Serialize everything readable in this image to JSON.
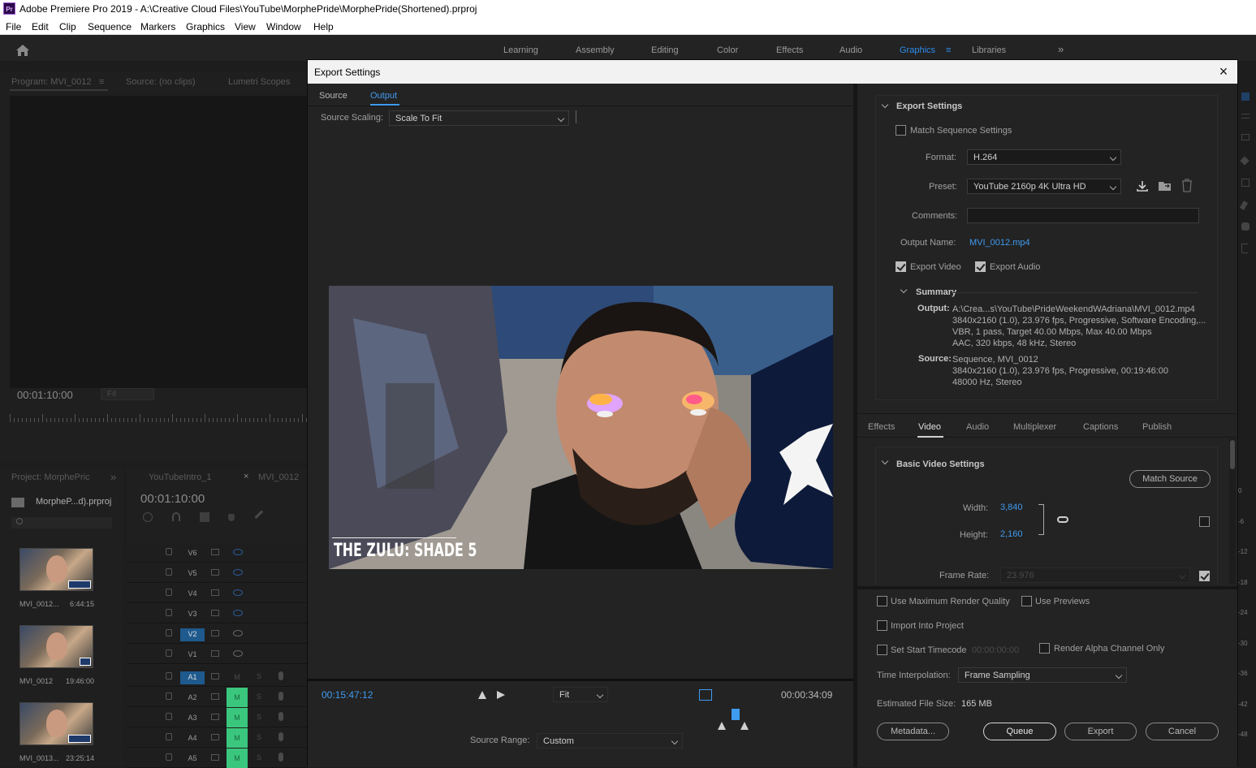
{
  "app": {
    "title": "Adobe Premiere Pro 2019 - A:\\Creative Cloud Files\\YouTube\\MorphePride\\MorphePride(Shortened).prproj",
    "logo": "Pr",
    "menu": [
      "File",
      "Edit",
      "Clip",
      "Sequence",
      "Markers",
      "Graphics",
      "View",
      "Window",
      "Help"
    ]
  },
  "workspaces": {
    "items": [
      "Learning",
      "Assembly",
      "Editing",
      "Color",
      "Effects",
      "Audio",
      "Graphics",
      "Libraries"
    ],
    "active": "Graphics",
    "more": "»",
    "menu_icon": "≡"
  },
  "monitor": {
    "tabs": [
      "Program: MVI_0012",
      "≡",
      "Source: (no clips)",
      "Lumetri Scopes"
    ],
    "timecode": "00:01:10:00",
    "fit": "Fit"
  },
  "project": {
    "tab": "Project: MorphePric",
    "more": "»",
    "file": "MorpheP...d).prproj",
    "clips": [
      {
        "name": "MVI_0012...",
        "duration": "6:44:15"
      },
      {
        "name": "MVI_0012",
        "duration": "19:46:00"
      },
      {
        "name": "MVI_0013...",
        "duration": "23:25:14"
      }
    ]
  },
  "timeline": {
    "tabs": [
      "YouTubeIntro_1",
      "×",
      "MVI_0012"
    ],
    "timecode": "00:01:10:00",
    "tracks": [
      {
        "name": "V6",
        "type": "video"
      },
      {
        "name": "V5",
        "type": "video"
      },
      {
        "name": "V4",
        "type": "video"
      },
      {
        "name": "V3",
        "type": "video"
      },
      {
        "name": "V2",
        "type": "video",
        "selected": true
      },
      {
        "name": "V1",
        "type": "video"
      },
      {
        "name": "A1",
        "type": "audio",
        "selected": true
      },
      {
        "name": "A2",
        "type": "audio"
      },
      {
        "name": "A3",
        "type": "audio"
      },
      {
        "name": "A4",
        "type": "audio"
      },
      {
        "name": "A5",
        "type": "audio"
      }
    ],
    "m_label": "M",
    "s_label": "S"
  },
  "meter_labels": [
    "0",
    "-6",
    "-12",
    "-18",
    "-24",
    "-30",
    "-36",
    "-42",
    "-48"
  ],
  "dialog": {
    "title": "Export Settings",
    "close": "×",
    "left_tabs": [
      "Source",
      "Output"
    ],
    "active_left_tab": "Output",
    "source_scaling_label": "Source Scaling:",
    "source_scaling_value": "Scale To Fit",
    "preview_caption": "THE ZULU: SHADE 5",
    "timecode_in": "00:15:47:12",
    "timecode_out": "00:00:34:09",
    "zoom_value": "Fit",
    "source_range_label": "Source Range:",
    "source_range_value": "Custom",
    "export_settings": {
      "header": "Export Settings",
      "match_sequence": "Match Sequence Settings",
      "format_label": "Format:",
      "format_value": "H.264",
      "preset_label": "Preset:",
      "preset_value": "YouTube 2160p 4K Ultra HD",
      "comments_label": "Comments:",
      "comments_value": "",
      "output_name_label": "Output Name:",
      "output_name_value": "MVI_0012.mp4",
      "export_video": "Export Video",
      "export_audio": "Export Audio"
    },
    "summary": {
      "header": "Summary",
      "output_label": "Output:",
      "output_lines": [
        "A:\\Crea...s\\YouTube\\PrideWeekendWAdriana\\MVI_0012.mp4",
        "3840x2160 (1.0), 23.976 fps, Progressive, Software Encoding,...",
        "VBR, 1 pass, Target 40.00 Mbps, Max 40.00 Mbps",
        "AAC, 320 kbps, 48 kHz, Stereo"
      ],
      "source_label": "Source:",
      "source_lines": [
        "Sequence, MVI_0012",
        "3840x2160 (1.0), 23.976 fps, Progressive, 00:19:46:00",
        "48000 Hz, Stereo"
      ]
    },
    "right_tabs": [
      "Effects",
      "Video",
      "Audio",
      "Multiplexer",
      "Captions",
      "Publish"
    ],
    "active_right_tab": "Video",
    "basic_video": {
      "header": "Basic Video Settings",
      "match_source": "Match Source",
      "width_label": "Width:",
      "width_value": "3,840",
      "height_label": "Height:",
      "height_value": "2,160",
      "frame_rate_label": "Frame Rate:",
      "frame_rate_value": "23.976"
    },
    "options": {
      "max_render": "Use Maximum Render Quality",
      "use_previews": "Use Previews",
      "import_project": "Import Into Project",
      "set_start_timecode": "Set Start Timecode",
      "start_timecode_value": "00:00:00:00",
      "render_alpha": "Render Alpha Channel Only",
      "time_interp_label": "Time Interpolation:",
      "time_interp_value": "Frame Sampling",
      "est_size_label": "Estimated File Size:",
      "est_size_value": "165 MB"
    },
    "buttons": {
      "metadata": "Metadata...",
      "queue": "Queue",
      "export": "Export",
      "cancel": "Cancel"
    }
  }
}
